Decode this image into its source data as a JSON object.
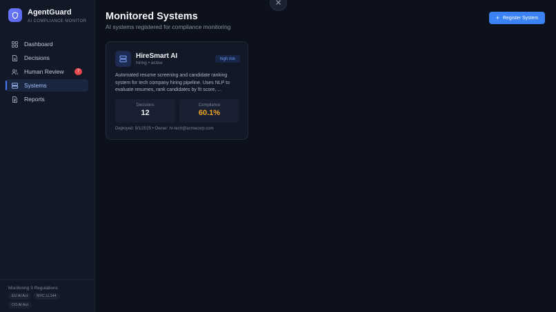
{
  "brand": {
    "name": "AgentGuard",
    "subtitle": "AI COMPLIANCE MONITOR",
    "icon": "shield-icon"
  },
  "sidebar": {
    "items": [
      {
        "label": "Dashboard",
        "icon": "grid-icon"
      },
      {
        "label": "Decisions",
        "icon": "document-icon"
      },
      {
        "label": "Human Review",
        "icon": "users-icon",
        "badge": "7"
      },
      {
        "label": "Systems",
        "icon": "server-icon",
        "active": true
      },
      {
        "label": "Reports",
        "icon": "report-icon"
      }
    ],
    "footer": {
      "title": "Monitoring 3 Regulations",
      "regulations": [
        "EU AI Act",
        "NYC LL144",
        "CO AI Act"
      ]
    }
  },
  "header": {
    "title": "Monitored Systems",
    "subtitle": "AI systems registered for compliance monitoring",
    "register_label": "Register System"
  },
  "systems": [
    {
      "name": "HireSmart AI",
      "meta": "hiring • active",
      "risk": "high risk",
      "description": "Automated resume screening and candidate ranking system for tech company hiring pipeline. Uses NLP to evaluate resumes, rank candidates by fit score, ...",
      "decisions_label": "Decisions",
      "decisions_value": "12",
      "compliance_label": "Compliance",
      "compliance_value": "60.1%",
      "footer": "Deployed: 9/1/2025 • Owner: hr-tech@acmecorp.com"
    }
  ],
  "colors": {
    "accent": "#3b82f6",
    "risk_text": "#6a9bff",
    "compliance_warn": "#f5a524",
    "badge": "#e5484d"
  }
}
